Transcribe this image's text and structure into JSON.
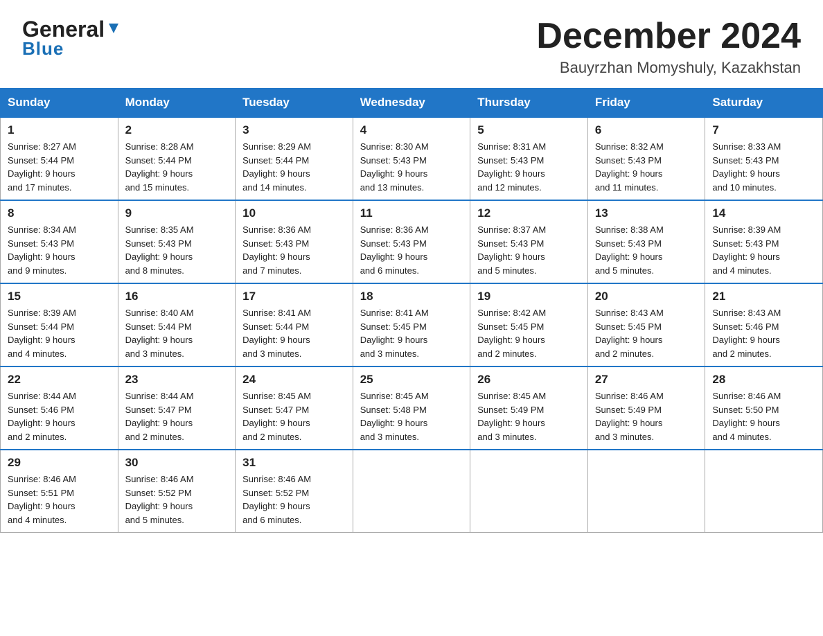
{
  "header": {
    "logo_general": "General",
    "logo_blue": "Blue",
    "title": "December 2024",
    "location": "Bauyrzhan Momyshuly, Kazakhstan"
  },
  "columns": [
    "Sunday",
    "Monday",
    "Tuesday",
    "Wednesday",
    "Thursday",
    "Friday",
    "Saturday"
  ],
  "weeks": [
    [
      {
        "day": "1",
        "sunrise": "Sunrise: 8:27 AM",
        "sunset": "Sunset: 5:44 PM",
        "daylight": "Daylight: 9 hours",
        "daylight2": "and 17 minutes."
      },
      {
        "day": "2",
        "sunrise": "Sunrise: 8:28 AM",
        "sunset": "Sunset: 5:44 PM",
        "daylight": "Daylight: 9 hours",
        "daylight2": "and 15 minutes."
      },
      {
        "day": "3",
        "sunrise": "Sunrise: 8:29 AM",
        "sunset": "Sunset: 5:44 PM",
        "daylight": "Daylight: 9 hours",
        "daylight2": "and 14 minutes."
      },
      {
        "day": "4",
        "sunrise": "Sunrise: 8:30 AM",
        "sunset": "Sunset: 5:43 PM",
        "daylight": "Daylight: 9 hours",
        "daylight2": "and 13 minutes."
      },
      {
        "day": "5",
        "sunrise": "Sunrise: 8:31 AM",
        "sunset": "Sunset: 5:43 PM",
        "daylight": "Daylight: 9 hours",
        "daylight2": "and 12 minutes."
      },
      {
        "day": "6",
        "sunrise": "Sunrise: 8:32 AM",
        "sunset": "Sunset: 5:43 PM",
        "daylight": "Daylight: 9 hours",
        "daylight2": "and 11 minutes."
      },
      {
        "day": "7",
        "sunrise": "Sunrise: 8:33 AM",
        "sunset": "Sunset: 5:43 PM",
        "daylight": "Daylight: 9 hours",
        "daylight2": "and 10 minutes."
      }
    ],
    [
      {
        "day": "8",
        "sunrise": "Sunrise: 8:34 AM",
        "sunset": "Sunset: 5:43 PM",
        "daylight": "Daylight: 9 hours",
        "daylight2": "and 9 minutes."
      },
      {
        "day": "9",
        "sunrise": "Sunrise: 8:35 AM",
        "sunset": "Sunset: 5:43 PM",
        "daylight": "Daylight: 9 hours",
        "daylight2": "and 8 minutes."
      },
      {
        "day": "10",
        "sunrise": "Sunrise: 8:36 AM",
        "sunset": "Sunset: 5:43 PM",
        "daylight": "Daylight: 9 hours",
        "daylight2": "and 7 minutes."
      },
      {
        "day": "11",
        "sunrise": "Sunrise: 8:36 AM",
        "sunset": "Sunset: 5:43 PM",
        "daylight": "Daylight: 9 hours",
        "daylight2": "and 6 minutes."
      },
      {
        "day": "12",
        "sunrise": "Sunrise: 8:37 AM",
        "sunset": "Sunset: 5:43 PM",
        "daylight": "Daylight: 9 hours",
        "daylight2": "and 5 minutes."
      },
      {
        "day": "13",
        "sunrise": "Sunrise: 8:38 AM",
        "sunset": "Sunset: 5:43 PM",
        "daylight": "Daylight: 9 hours",
        "daylight2": "and 5 minutes."
      },
      {
        "day": "14",
        "sunrise": "Sunrise: 8:39 AM",
        "sunset": "Sunset: 5:43 PM",
        "daylight": "Daylight: 9 hours",
        "daylight2": "and 4 minutes."
      }
    ],
    [
      {
        "day": "15",
        "sunrise": "Sunrise: 8:39 AM",
        "sunset": "Sunset: 5:44 PM",
        "daylight": "Daylight: 9 hours",
        "daylight2": "and 4 minutes."
      },
      {
        "day": "16",
        "sunrise": "Sunrise: 8:40 AM",
        "sunset": "Sunset: 5:44 PM",
        "daylight": "Daylight: 9 hours",
        "daylight2": "and 3 minutes."
      },
      {
        "day": "17",
        "sunrise": "Sunrise: 8:41 AM",
        "sunset": "Sunset: 5:44 PM",
        "daylight": "Daylight: 9 hours",
        "daylight2": "and 3 minutes."
      },
      {
        "day": "18",
        "sunrise": "Sunrise: 8:41 AM",
        "sunset": "Sunset: 5:45 PM",
        "daylight": "Daylight: 9 hours",
        "daylight2": "and 3 minutes."
      },
      {
        "day": "19",
        "sunrise": "Sunrise: 8:42 AM",
        "sunset": "Sunset: 5:45 PM",
        "daylight": "Daylight: 9 hours",
        "daylight2": "and 2 minutes."
      },
      {
        "day": "20",
        "sunrise": "Sunrise: 8:43 AM",
        "sunset": "Sunset: 5:45 PM",
        "daylight": "Daylight: 9 hours",
        "daylight2": "and 2 minutes."
      },
      {
        "day": "21",
        "sunrise": "Sunrise: 8:43 AM",
        "sunset": "Sunset: 5:46 PM",
        "daylight": "Daylight: 9 hours",
        "daylight2": "and 2 minutes."
      }
    ],
    [
      {
        "day": "22",
        "sunrise": "Sunrise: 8:44 AM",
        "sunset": "Sunset: 5:46 PM",
        "daylight": "Daylight: 9 hours",
        "daylight2": "and 2 minutes."
      },
      {
        "day": "23",
        "sunrise": "Sunrise: 8:44 AM",
        "sunset": "Sunset: 5:47 PM",
        "daylight": "Daylight: 9 hours",
        "daylight2": "and 2 minutes."
      },
      {
        "day": "24",
        "sunrise": "Sunrise: 8:45 AM",
        "sunset": "Sunset: 5:47 PM",
        "daylight": "Daylight: 9 hours",
        "daylight2": "and 2 minutes."
      },
      {
        "day": "25",
        "sunrise": "Sunrise: 8:45 AM",
        "sunset": "Sunset: 5:48 PM",
        "daylight": "Daylight: 9 hours",
        "daylight2": "and 3 minutes."
      },
      {
        "day": "26",
        "sunrise": "Sunrise: 8:45 AM",
        "sunset": "Sunset: 5:49 PM",
        "daylight": "Daylight: 9 hours",
        "daylight2": "and 3 minutes."
      },
      {
        "day": "27",
        "sunrise": "Sunrise: 8:46 AM",
        "sunset": "Sunset: 5:49 PM",
        "daylight": "Daylight: 9 hours",
        "daylight2": "and 3 minutes."
      },
      {
        "day": "28",
        "sunrise": "Sunrise: 8:46 AM",
        "sunset": "Sunset: 5:50 PM",
        "daylight": "Daylight: 9 hours",
        "daylight2": "and 4 minutes."
      }
    ],
    [
      {
        "day": "29",
        "sunrise": "Sunrise: 8:46 AM",
        "sunset": "Sunset: 5:51 PM",
        "daylight": "Daylight: 9 hours",
        "daylight2": "and 4 minutes."
      },
      {
        "day": "30",
        "sunrise": "Sunrise: 8:46 AM",
        "sunset": "Sunset: 5:52 PM",
        "daylight": "Daylight: 9 hours",
        "daylight2": "and 5 minutes."
      },
      {
        "day": "31",
        "sunrise": "Sunrise: 8:46 AM",
        "sunset": "Sunset: 5:52 PM",
        "daylight": "Daylight: 9 hours",
        "daylight2": "and 6 minutes."
      },
      null,
      null,
      null,
      null
    ]
  ]
}
